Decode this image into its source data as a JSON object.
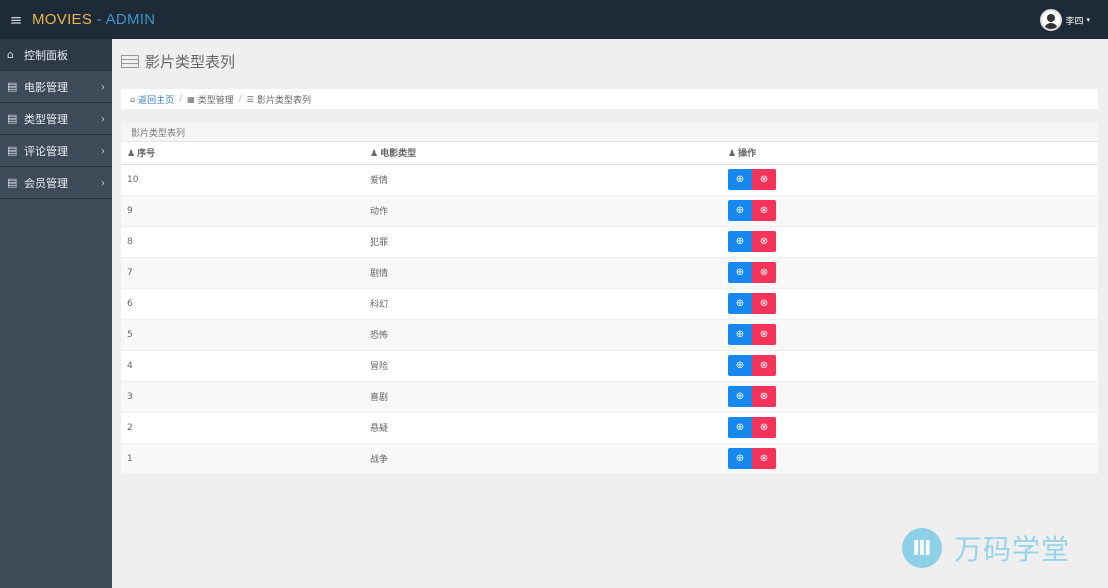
{
  "header": {
    "menu_icon": "hamburger-icon",
    "brand_part1": "MOVIES",
    "brand_sep": " - ",
    "brand_part2": "ADMIN",
    "user_name": "李四",
    "user_caret": "▾"
  },
  "sidebar": {
    "items": [
      {
        "label": "控制面板",
        "icon": "home-icon",
        "active": true
      },
      {
        "label": "电影管理",
        "icon": "file-icon"
      },
      {
        "label": "类型管理",
        "icon": "file-icon"
      },
      {
        "label": "评论管理",
        "icon": "file-icon"
      },
      {
        "label": "会员管理",
        "icon": "file-icon"
      }
    ]
  },
  "page": {
    "title": "影片类型表列"
  },
  "breadcrumb": {
    "home": "返回主页",
    "level2": "类型管理",
    "level3": "影片类型表列"
  },
  "panel": {
    "heading": "影片类型表列",
    "columns": [
      "序号",
      "电影类型",
      "操作"
    ],
    "rows": [
      {
        "id": "10",
        "type": "爱情"
      },
      {
        "id": "9",
        "type": "动作"
      },
      {
        "id": "8",
        "type": "犯罪"
      },
      {
        "id": "7",
        "type": "剧情"
      },
      {
        "id": "6",
        "type": "科幻"
      },
      {
        "id": "5",
        "type": "恐怖"
      },
      {
        "id": "4",
        "type": "冒险"
      },
      {
        "id": "3",
        "type": "喜剧"
      },
      {
        "id": "2",
        "type": "悬疑"
      },
      {
        "id": "1",
        "type": "战争"
      }
    ],
    "add_glyph": "⊕",
    "delete_glyph": "⊗"
  },
  "watermark": {
    "text": "万码学堂"
  },
  "colors": {
    "topbar": "#1f2a38",
    "sidebar": "#3e4a57",
    "add_button": "#1788f0",
    "delete_button": "#f4335a",
    "brand_primary": "#e8b84a",
    "brand_secondary": "#3a97c9"
  }
}
